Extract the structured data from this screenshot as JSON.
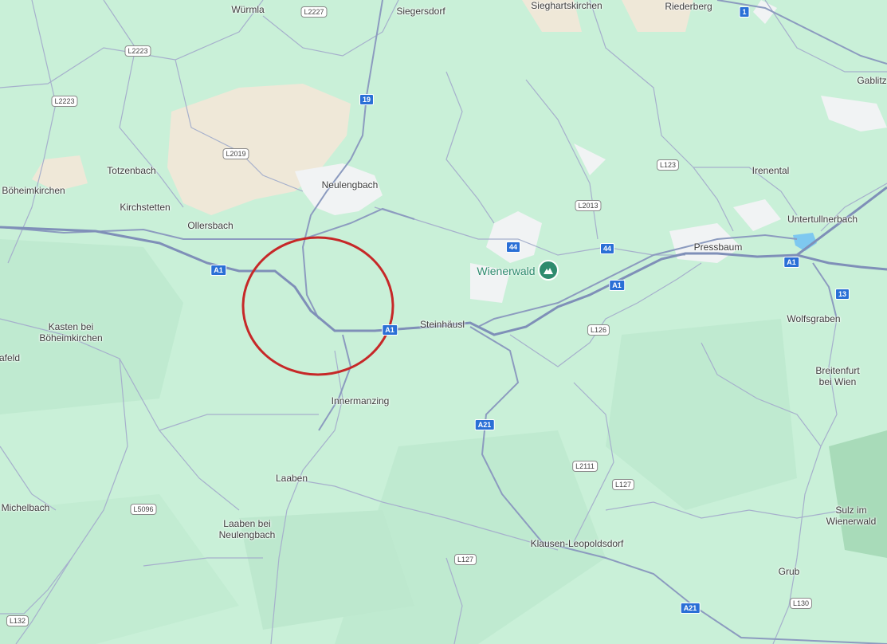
{
  "places": [
    {
      "name": "Würmla",
      "id": "wurmla"
    },
    {
      "name": "Siegersdorf",
      "id": "siegersdorf"
    },
    {
      "name": "Sieghartskirchen",
      "id": "sieghartskirchen"
    },
    {
      "name": "Riederberg",
      "id": "riederberg"
    },
    {
      "name": "Gablitz",
      "id": "gablitz"
    },
    {
      "name": "Totzenbach",
      "id": "totzenbach"
    },
    {
      "name": "Böheimkirchen",
      "id": "boheimkirchen"
    },
    {
      "name": "Kirchstetten",
      "id": "kirchstetten"
    },
    {
      "name": "Ollersbach",
      "id": "ollersbach"
    },
    {
      "name": "Neulengbach",
      "id": "neulengbach"
    },
    {
      "name": "Irenental",
      "id": "irenental"
    },
    {
      "name": "Untertullnerbach",
      "id": "untertullnerbach"
    },
    {
      "name": "Pressbaum",
      "id": "pressbaum"
    },
    {
      "name": "Kasten bei\nBöheimkirchen",
      "id": "kasten"
    },
    {
      "name": "afeld",
      "id": "afeld"
    },
    {
      "name": "Steinhäusl",
      "id": "steinhausl"
    },
    {
      "name": "Wolfsgraben",
      "id": "wolfsgraben"
    },
    {
      "name": "Breitenfurt\nbei Wien",
      "id": "breitenfurt"
    },
    {
      "name": "Innermanzing",
      "id": "innermanzing"
    },
    {
      "name": "Laaben",
      "id": "laaben"
    },
    {
      "name": "Michelbach",
      "id": "michelbach"
    },
    {
      "name": "Laaben bei\nNeulengbach",
      "id": "laaben-bei-neulengbach"
    },
    {
      "name": "Sulz im\nWienerwald",
      "id": "sulz"
    },
    {
      "name": "Klausen-Leopoldsdorf",
      "id": "klausen"
    },
    {
      "name": "Grub",
      "id": "grub"
    }
  ],
  "poi": {
    "name": "Wienerwald",
    "icon": "mountain-icon",
    "color": "#2e8b6e"
  },
  "shields_blue": [
    "1",
    "19",
    "44",
    "44",
    "A1",
    "A1",
    "A1",
    "A1",
    "13",
    "A21",
    "A21"
  ],
  "shields_white": [
    "L2227",
    "L2223",
    "L2223",
    "L2019",
    "L2013",
    "L123",
    "L126",
    "L2111",
    "L127",
    "L5096",
    "L127",
    "L130",
    "L132"
  ],
  "highlight": {
    "color": "#c62828"
  },
  "colors": {
    "land": "#c9f0d8",
    "urban": "#f1f3f4",
    "field": "#efe8d8",
    "motorway": "#8b9bc4",
    "road": "#9aa7c8",
    "water": "#7ec8f0"
  }
}
